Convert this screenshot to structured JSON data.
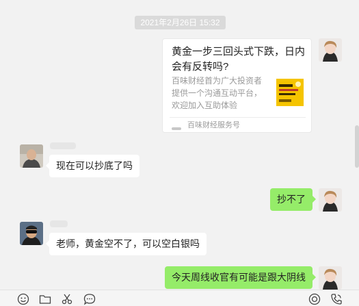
{
  "chat": {
    "timestamp": "2021年2月26日 15:32",
    "card": {
      "title": "黄金一步三回头式下跌，日内会有反转吗?",
      "description": "百味财经首为广大投资者提供一个沟通互动平台，欢迎加入互助体验",
      "source": "百味财经服务号",
      "thumb_color": "#f5c400"
    },
    "messages": [
      {
        "direction": "in",
        "text": "现在可以抄底了吗"
      },
      {
        "direction": "out",
        "text": "抄不了"
      },
      {
        "direction": "in",
        "text": "老师，黄金空不了，可以空白银吗"
      },
      {
        "direction": "out",
        "text": "今天周线收官有可能是跟大阴线"
      }
    ],
    "colors": {
      "background": "#f2f2f2",
      "bubble_out": "#95ec69",
      "bubble_in": "#ffffff"
    }
  },
  "toolbar": {
    "icons": [
      "emoji-icon",
      "folder-icon",
      "scissors-icon",
      "chat-history-icon",
      "live-icon",
      "voice-call-icon"
    ]
  }
}
